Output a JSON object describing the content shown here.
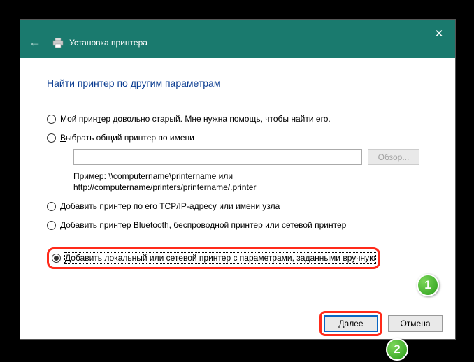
{
  "header": {
    "title": "Установка принтера"
  },
  "heading": "Найти принтер по другим параметрам",
  "options": {
    "old": "Мой принтер довольно старый. Мне нужна помощь, чтобы найти его.",
    "shared": "Выбрать общий принтер по имени",
    "tcpip": "Добавить принтер по его TCP/IP-адресу или имени узла",
    "bluetooth": "Добавить принтер Bluetooth, беспроводной принтер или сетевой принтер",
    "manual": "Добавить локальный или сетевой принтер с параметрами, заданными вручную"
  },
  "input": {
    "value": "",
    "browse": "Обзор...",
    "hint1": "Пример: \\\\computername\\printername или",
    "hint2": "http://computername/printers/printername/.printer"
  },
  "footer": {
    "next": "Далее",
    "cancel": "Отмена"
  },
  "badges": {
    "b1": "1",
    "b2": "2"
  }
}
